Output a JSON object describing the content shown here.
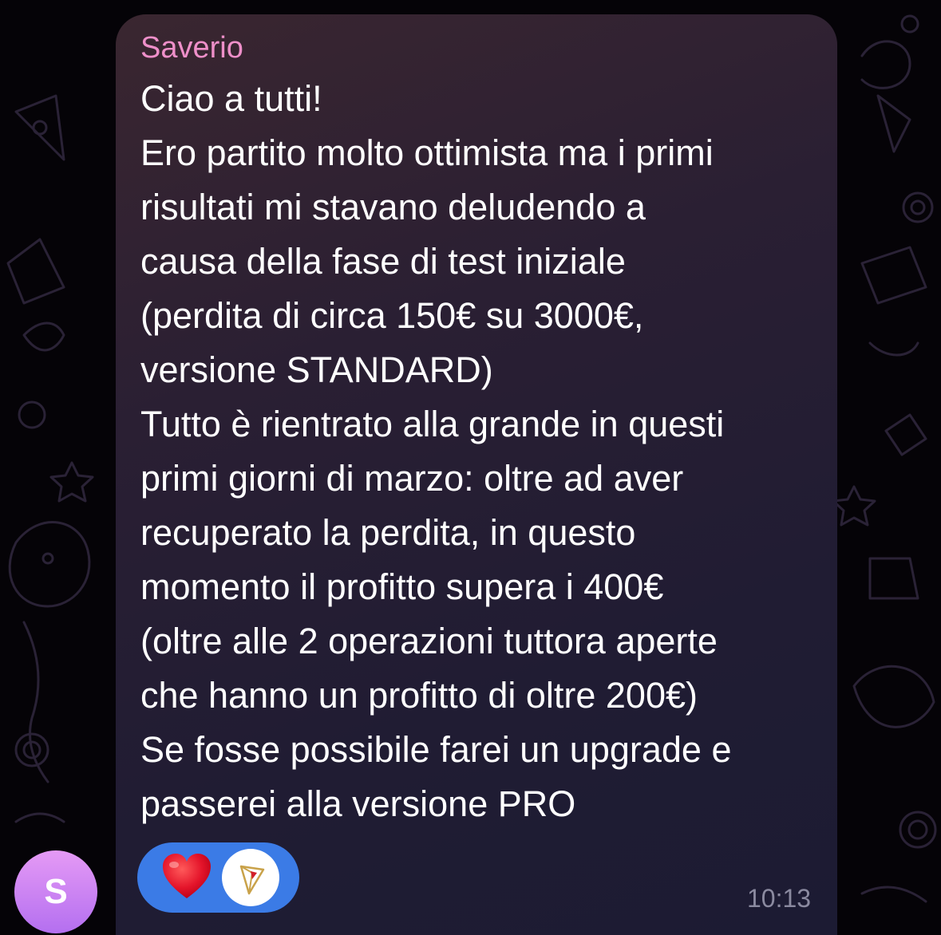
{
  "message": {
    "sender": "Saverio",
    "lines": [
      "Ciao a tutti!",
      "Ero partito molto ottimista ma i primi",
      "risultati mi stavano deludendo a",
      "causa della fase di test iniziale",
      "(perdita di circa 150€ su 3000€,",
      "versione STANDARD)",
      "Tutto è rientrato alla grande in questi",
      "primi giorni di marzo: oltre ad aver",
      "recuperato la perdita, in questo",
      "momento il profitto supera i 400€",
      "(oltre alle 2 operazioni tuttora aperte",
      "che hanno un profitto di oltre 200€)",
      "Se fosse possibile farei un upgrade e",
      "passerei alla versione PRO"
    ],
    "time": "10:13",
    "avatar_initial": "S"
  },
  "reactions": [
    {
      "icon": "red-heart-icon",
      "type": "emoji"
    },
    {
      "icon": "reactor-avatar-icon",
      "type": "user-avatar"
    }
  ],
  "colors": {
    "sender_name": "#ee8fc9",
    "reaction_pill": "#3b7be6",
    "time": "#8b8aa0",
    "avatar_gradient_top": "#e59af5",
    "avatar_gradient_bottom": "#b46ff0"
  }
}
